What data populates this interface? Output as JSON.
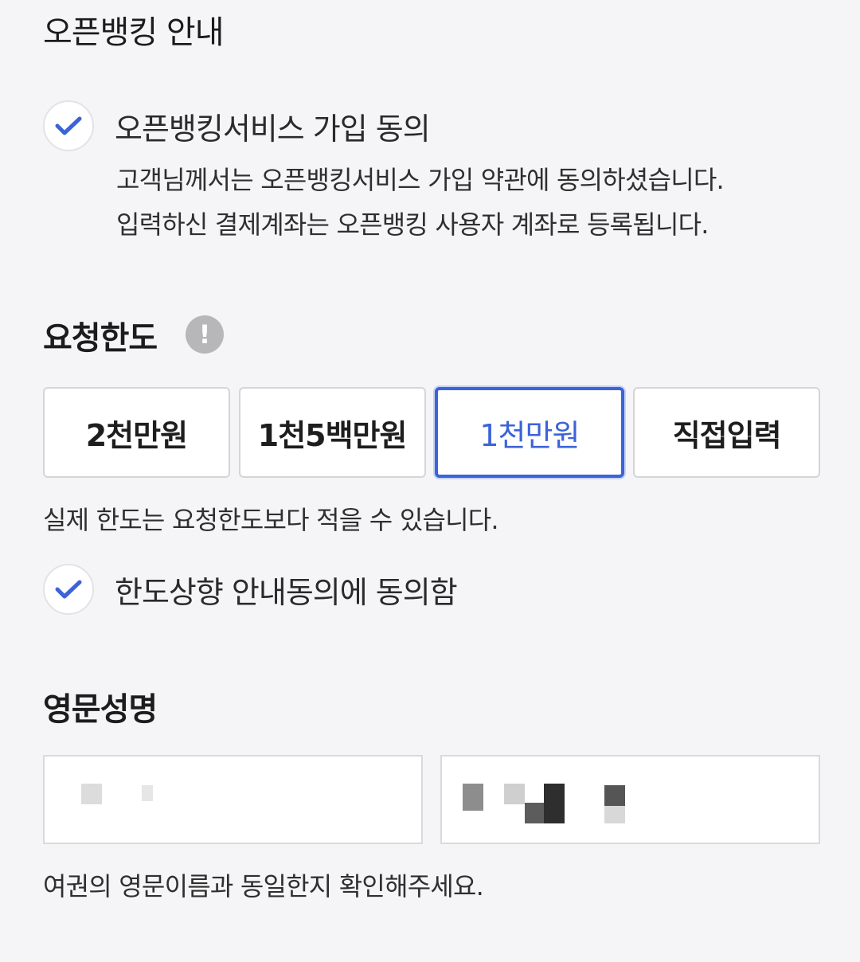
{
  "openbanking": {
    "title": "오픈뱅킹 안내",
    "agree_label": "오픈뱅킹서비스 가입 동의",
    "desc_line1": "고객님께서는 오픈뱅킹서비스 가입 약관에 동의하셨습니다.",
    "desc_line2": "입력하신 결제계좌는 오픈뱅킹 사용자 계좌로 등록됩니다."
  },
  "limit": {
    "title": "요청한도",
    "info_icon": "!",
    "options": [
      "2천만원",
      "1천5백만원",
      "1천만원",
      "직접입력"
    ],
    "selected": "1천만원",
    "note": "실제 한도는 요청한도보다 적을 수 있습니다.",
    "agree_label": "한도상향 안내동의에 동의함"
  },
  "english_name": {
    "title": "영문성명",
    "first_value": "",
    "last_value": "",
    "note": "여권의 영문이름과 동일한지 확인해주세요."
  },
  "colors": {
    "accent": "#3c63d8",
    "background": "#f5f5f7",
    "info_icon": "#b7b7b9"
  }
}
